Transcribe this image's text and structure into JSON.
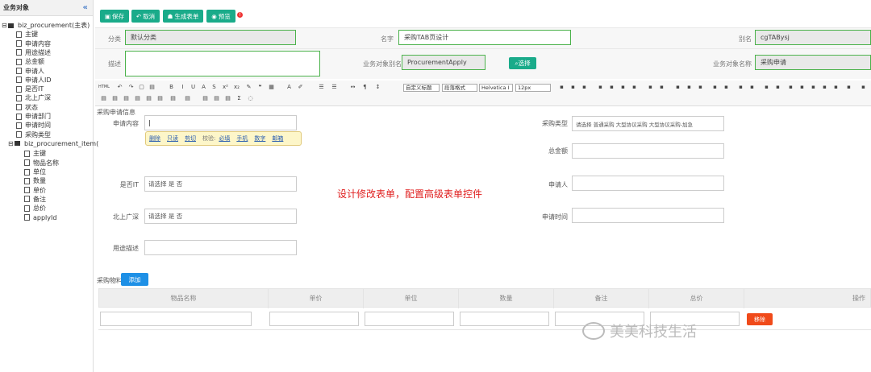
{
  "sidebar": {
    "title": "业务对象",
    "collapse_glyph": "«",
    "root": "biz_procurement(主表)",
    "root_items": [
      "主键",
      "申请内容",
      "用途描述",
      "总金额",
      "申请人",
      "申请人ID",
      "是否IT",
      "北上广深",
      "状态",
      "申请部门",
      "申请时间",
      "采购类型"
    ],
    "child": "biz_procurement_item(",
    "child_items": [
      "主键",
      "物品名称",
      "单位",
      "数量",
      "单价",
      "备注",
      "总价",
      "applyId"
    ]
  },
  "toolbar_buttons": {
    "save": "保存",
    "cancel": "取消",
    "generate": "生成表单",
    "preview": "预览",
    "warn": "!"
  },
  "form": {
    "category_label": "分类",
    "category_value": "默认分类",
    "name_label": "名字",
    "name_value": "采购TAB页设计",
    "alias_label": "别名",
    "alias_value": "cgTABysj",
    "desc_label": "描述",
    "desc_value": "",
    "bizalias_label": "业务对象别名",
    "bizalias_value": "ProcurementApply",
    "select_button": "选择",
    "bizname_label": "业务对象名称",
    "bizname_value": "采购申请"
  },
  "editor_toolbar": {
    "html_label": "HTML",
    "font_style": "自定义标题",
    "para_format": "段落格式",
    "font_family": "Helvetica I",
    "font_size": "12px"
  },
  "editor": {
    "section_title": "采购申请信息",
    "apply_content_label": "申请内容",
    "purchase_type_label": "采购类型",
    "purchase_type_value": "请选择 普通采购 大型协议采购 大型协议采购-加急",
    "total_label": "总金额",
    "is_it_label": "是否IT",
    "is_it_value": "请选择 是 否",
    "applicant_label": "申请人",
    "tier1_label": "北上广深",
    "tier1_value": "请选择 是 否",
    "apply_time_label": "申请时间",
    "usage_label": "用途描述",
    "popup": {
      "delete": "删除",
      "readonly": "只读",
      "cut": "剪切",
      "verify_label": "校验:",
      "required": "必填",
      "phone": "手机",
      "number": "数字",
      "email": "邮箱"
    },
    "note": "设计修改表单，配置高级表单控件"
  },
  "materials": {
    "section_title": "采购物料",
    "add_button": "添加",
    "columns": [
      "物品名称",
      "单价",
      "单位",
      "数量",
      "备注",
      "总价",
      "操作"
    ],
    "remove_button": "移除"
  },
  "watermark": "美美科技生活"
}
